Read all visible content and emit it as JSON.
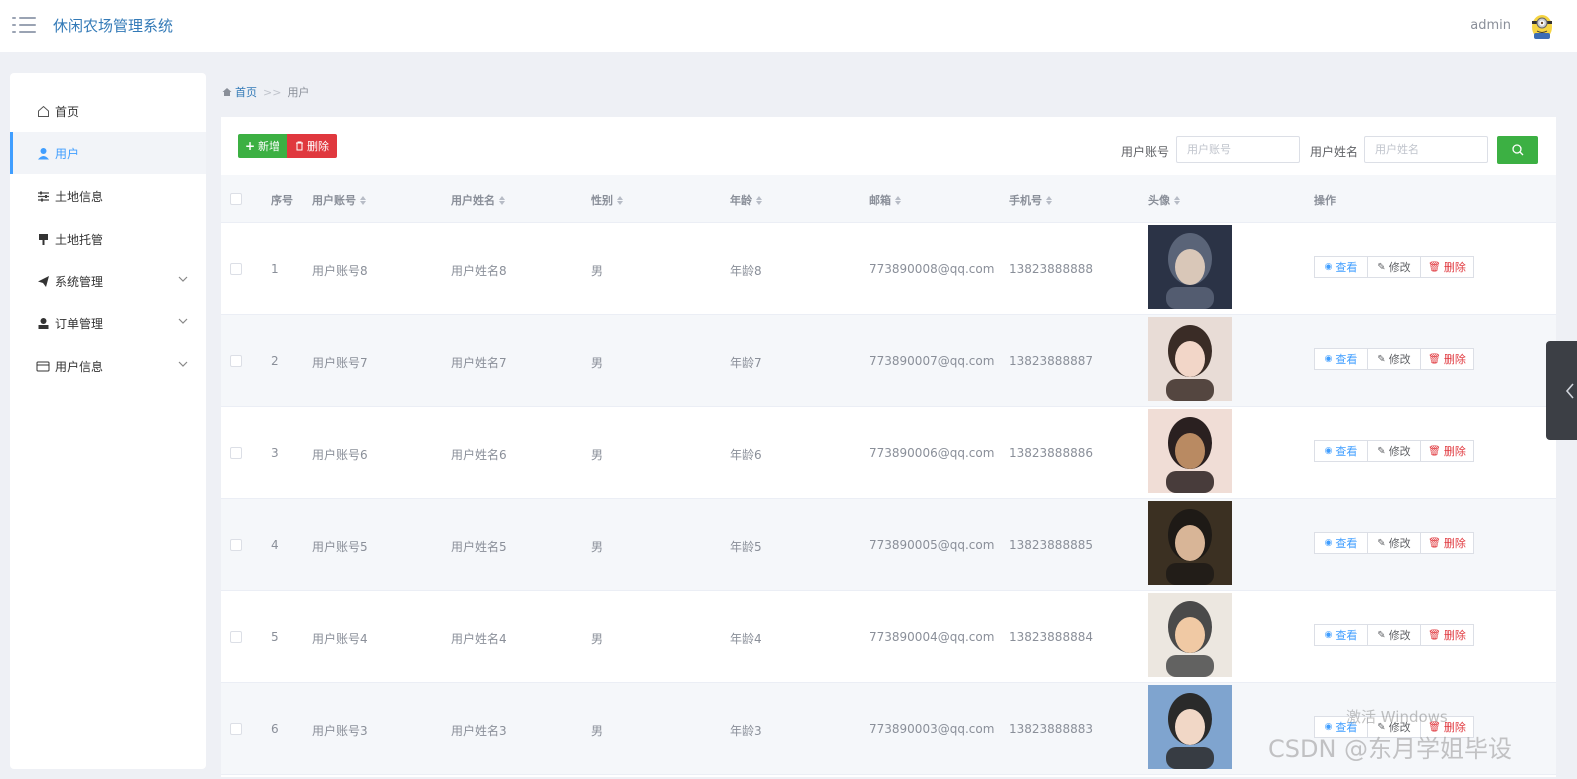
{
  "header": {
    "title": "休闲农场管理系统",
    "user": "admin"
  },
  "sidebar": {
    "items": [
      {
        "label": "首页",
        "icon": "home-icon"
      },
      {
        "label": "用户",
        "icon": "user-icon",
        "active": true
      },
      {
        "label": "土地信息",
        "icon": "sliders-icon"
      },
      {
        "label": "土地托管",
        "icon": "stamp-icon"
      },
      {
        "label": "系统管理",
        "icon": "paper-plane-icon",
        "expandable": true
      },
      {
        "label": "订单管理",
        "icon": "person-icon",
        "expandable": true
      },
      {
        "label": "用户信息",
        "icon": "card-icon",
        "expandable": true
      }
    ]
  },
  "breadcrumb": {
    "home": "首页",
    "sep": ">>",
    "current": "用户"
  },
  "toolbar": {
    "add_label": "新增",
    "delete_label": "删除"
  },
  "search": {
    "account_label": "用户账号",
    "account_placeholder": "用户账号",
    "name_label": "用户姓名",
    "name_placeholder": "用户姓名"
  },
  "table": {
    "headers": {
      "index": "序号",
      "account": "用户账号",
      "name": "用户姓名",
      "gender": "性别",
      "age": "年龄",
      "email": "邮箱",
      "phone": "手机号",
      "avatar": "头像",
      "ops": "操作"
    },
    "actions": {
      "view": "查看",
      "edit": "修改",
      "delete": "删除"
    },
    "rows": [
      {
        "index": "1",
        "account": "用户账号8",
        "name": "用户姓名8",
        "gender": "男",
        "age": "年龄8",
        "email": "773890008@qq.com",
        "phone": "13823888888"
      },
      {
        "index": "2",
        "account": "用户账号7",
        "name": "用户姓名7",
        "gender": "男",
        "age": "年龄7",
        "email": "773890007@qq.com",
        "phone": "13823888887"
      },
      {
        "index": "3",
        "account": "用户账号6",
        "name": "用户姓名6",
        "gender": "男",
        "age": "年龄6",
        "email": "773890006@qq.com",
        "phone": "13823888886"
      },
      {
        "index": "4",
        "account": "用户账号5",
        "name": "用户姓名5",
        "gender": "男",
        "age": "年龄5",
        "email": "773890005@qq.com",
        "phone": "13823888885"
      },
      {
        "index": "5",
        "account": "用户账号4",
        "name": "用户姓名4",
        "gender": "男",
        "age": "年龄4",
        "email": "773890004@qq.com",
        "phone": "13823888884"
      },
      {
        "index": "6",
        "account": "用户账号3",
        "name": "用户姓名3",
        "gender": "男",
        "age": "年龄3",
        "email": "773890003@qq.com",
        "phone": "13823888883"
      }
    ]
  },
  "watermarks": {
    "windows": "激活 Windows",
    "csdn": "CSDN @东月学姐毕设"
  },
  "colors": {
    "primary": "#409eff",
    "success": "#3cb043",
    "danger": "#e0383e",
    "title": "#337ab7"
  }
}
